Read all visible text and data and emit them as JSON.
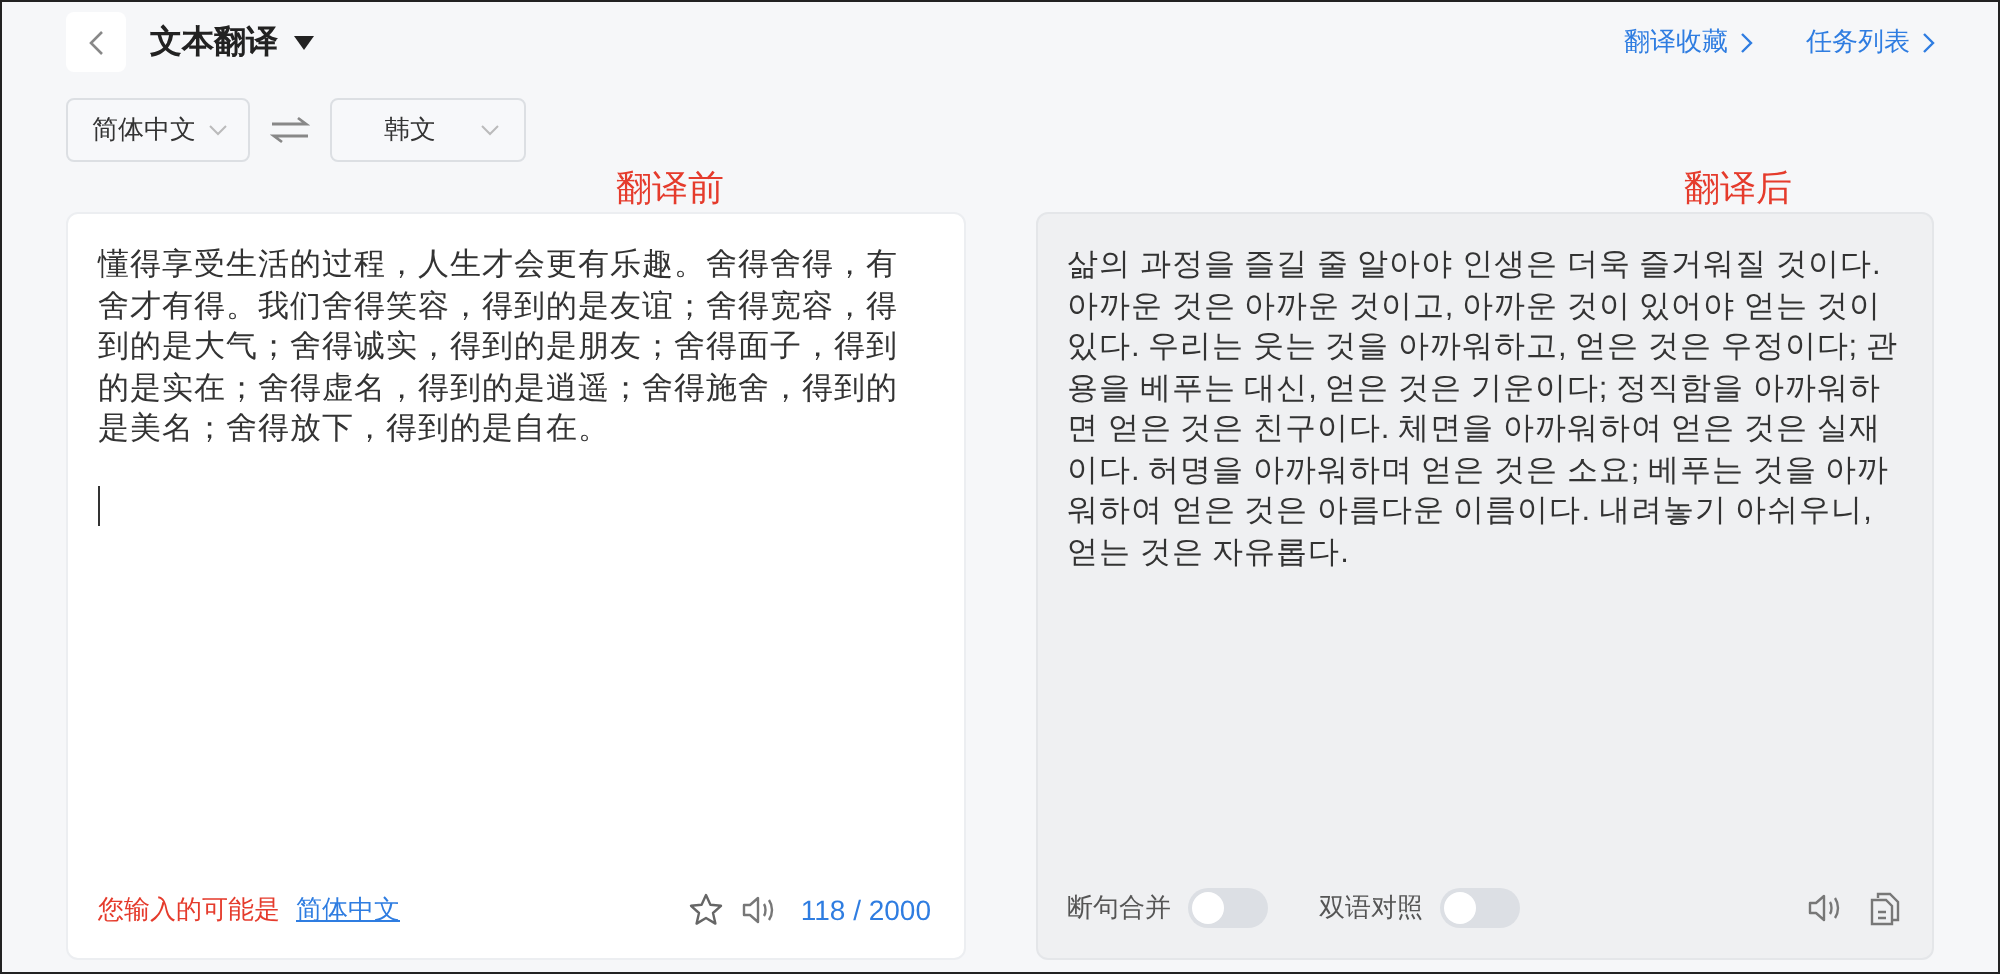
{
  "header": {
    "title": "文本翻译",
    "links": [
      {
        "label": "翻译收藏"
      },
      {
        "label": "任务列表"
      }
    ]
  },
  "languages": {
    "source": "简体中文",
    "target": "韩文"
  },
  "annotations": [
    {
      "label": "翻译前"
    },
    {
      "label": "翻译后"
    }
  ],
  "source_panel": {
    "text": "懂得享受生活的过程，人生才会更有乐趣。舍得舍得，有舍才有得。我们舍得笑容，得到的是友谊；舍得宽容，得到的是大气；舍得诚实，得到的是朋友；舍得面子，得到的是实在；舍得虚名，得到的是逍遥；舍得施舍，得到的是美名；舍得放下，得到的是自在。",
    "detect_label": "您输入的可能是",
    "detect_link": "简体中文",
    "favorited": false,
    "count": "118 / 2000"
  },
  "target_panel": {
    "text": "삶의 과정을 즐길 줄 알아야 인생은 더욱 즐거워질 것이다. 아까운 것은 아까운 것이고, 아까운 것이 있어야 얻는 것이 있다. 우리는 웃는 것을 아까워하고, 얻은 것은 우정이다; 관용을 베푸는 대신, 얻은 것은 기운이다; 정직함을 아까워하면 얻은 것은 친구이다. 체면을 아까워하여 얻은 것은 실재이다. 허명을 아까워하며 얻은 것은 소요; 베푸는 것을 아까워하여 얻은 것은 아름다운 이름이다. 내려놓기 아쉬우니, 얻는 것은 자유롭다.",
    "toggles": [
      {
        "label": "断句合并",
        "on": false
      },
      {
        "label": "双语对照",
        "on": false
      }
    ]
  }
}
